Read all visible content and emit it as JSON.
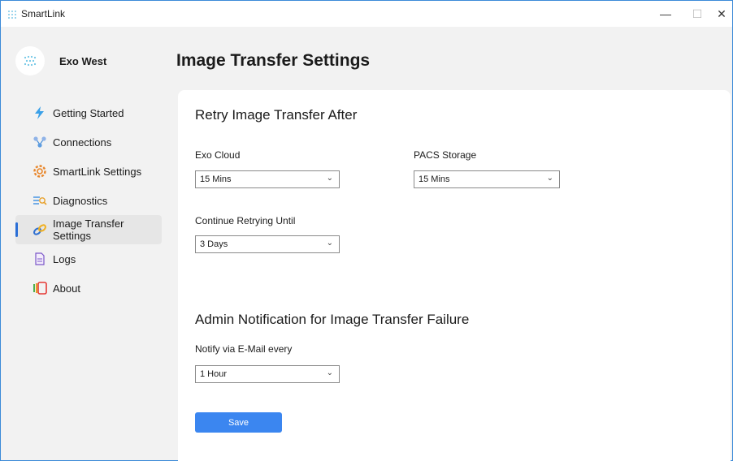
{
  "window": {
    "title": "SmartLink",
    "minimize_glyph": "—",
    "maximize_glyph": "☐",
    "close_glyph": "✕"
  },
  "profile": {
    "name": "Exo West"
  },
  "nav": {
    "items": [
      {
        "label": "Getting Started",
        "icon": "bolt-icon"
      },
      {
        "label": "Connections",
        "icon": "connections-icon"
      },
      {
        "label": "SmartLink Settings",
        "icon": "gear-icon"
      },
      {
        "label": "Diagnostics",
        "icon": "diagnostics-icon"
      },
      {
        "label": "Image Transfer Settings",
        "icon": "link-icon",
        "active": true
      },
      {
        "label": "Logs",
        "icon": "document-icon"
      },
      {
        "label": "About",
        "icon": "about-icon"
      }
    ]
  },
  "page": {
    "title": "Image Transfer Settings",
    "retry_section": {
      "title": "Retry Image Transfer After",
      "exo_cloud": {
        "label": "Exo Cloud",
        "value": "15 Mins"
      },
      "pacs_storage": {
        "label": "PACS Storage",
        "value": "15 Mins"
      },
      "continue_until": {
        "label": "Continue Retrying Until",
        "value": "3 Days"
      }
    },
    "notification_section": {
      "title": "Admin Notification for Image Transfer Failure",
      "notify_email": {
        "label": "Notify via E-Mail every",
        "value": "1 Hour"
      }
    },
    "save_label": "Save"
  },
  "colors": {
    "accent": "#3b86f0",
    "active_indicator": "#2b6fd6",
    "window_border": "#3b8ad8"
  }
}
